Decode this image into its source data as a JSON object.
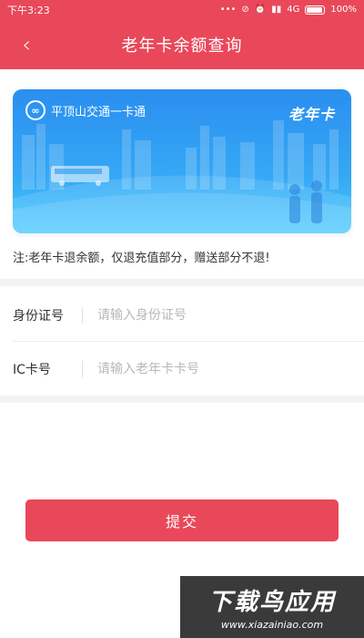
{
  "status_bar": {
    "time": "下午3:23",
    "dots": "•••",
    "network": "4G",
    "battery": "100%"
  },
  "header": {
    "back_icon": "‹",
    "title": "老年卡余额查询"
  },
  "card": {
    "brand": "平顶山交通一卡通",
    "logo_mark": "∞",
    "type": "老年卡",
    "colors": {
      "top": "#2a8ef0",
      "bottom": "#47c9ff"
    }
  },
  "note": "注:老年卡退余额，仅退充值部分，赠送部分不退!",
  "form": {
    "id_label": "身份证号",
    "id_placeholder": "请输入身份证号",
    "ic_label": "IC卡号",
    "ic_placeholder": "请输入老年卡卡号"
  },
  "submit_label": "提交",
  "watermark": {
    "main": "下载鸟应用",
    "url": "www.xiazainiao.com"
  },
  "colors": {
    "accent": "#e8485a"
  }
}
